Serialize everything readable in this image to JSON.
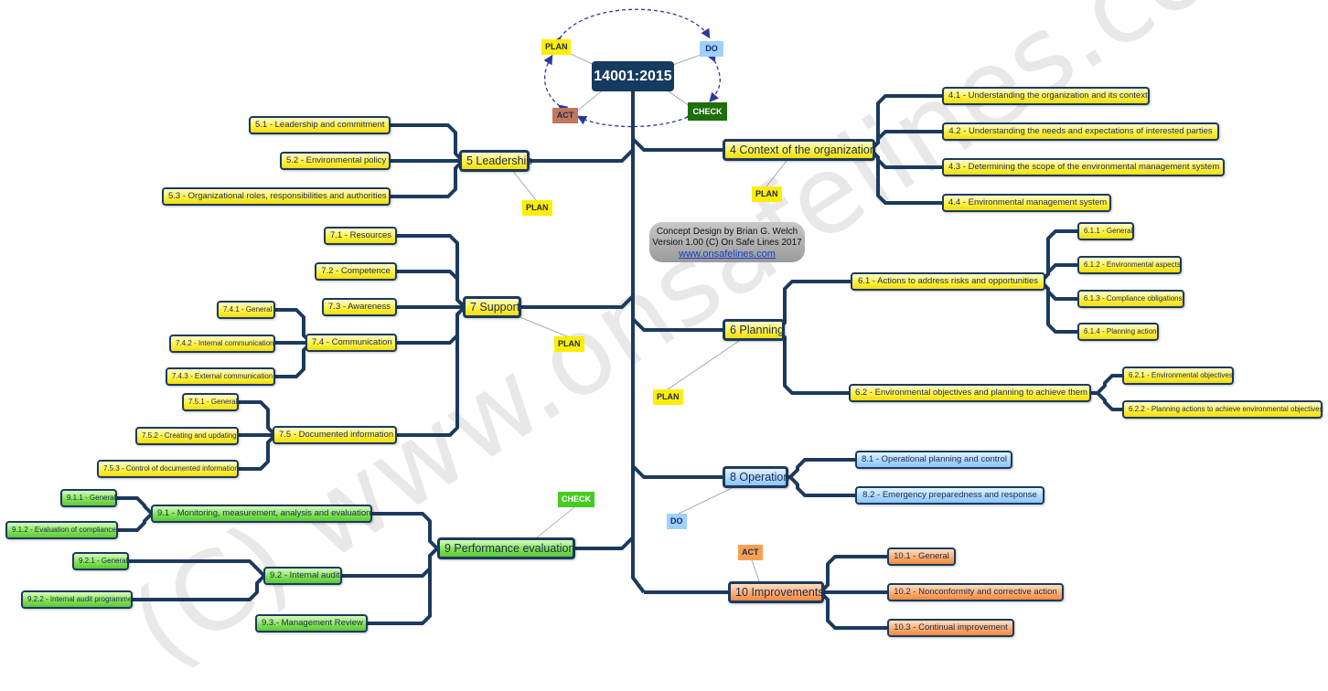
{
  "root": "14001:2015",
  "cycle": {
    "plan": "PLAN",
    "do": "DO",
    "check": "CHECK",
    "act": "ACT",
    "colors": {
      "plan": "#ffee00",
      "do": "#9fd0ff",
      "check": "#1e6e0e",
      "act": "#c0785a"
    }
  },
  "credit": {
    "line1": "Concept Design by Brian G. Welch",
    "line2": "Version 1.00 (C) On Safe Lines 2017",
    "link": "www.onsafelines.com"
  },
  "watermark": "(C) www.onsafelines.com",
  "tags": {
    "t5": "PLAN",
    "t4": "PLAN",
    "t7": "PLAN",
    "t6": "PLAN",
    "t9": "CHECK",
    "t8": "DO",
    "t10": "ACT"
  },
  "nodes": {
    "n4": "4 Context of the organization",
    "n4_1": "4.1 - Understanding the organization and its context",
    "n4_2": "4.2 - Understanding the needs and expectations of interested parties",
    "n4_3": "4.3 - Determining the scope of the environmental management system",
    "n4_4": "4.4 - Environmental management system",
    "n5": "5 Leadership",
    "n5_1": "5.1 - Leadership and commitment",
    "n5_2": "5.2 - Environmental policy",
    "n5_3": "5.3 - Organizational roles, responsibilities and authorities",
    "n6": "6 Planning",
    "n6_1": "6.1 - Actions to address risks and opportunities",
    "n6_1_1": "6.1.1 - General",
    "n6_1_2": "6.1.2 - Environmental aspects",
    "n6_1_3": "6.1.3 - Compliance obligations",
    "n6_1_4": "6.1.4 - Planning action",
    "n6_2": "6.2 - Environmental objectives and planning to achieve them",
    "n6_2_1": "6.2.1 - Environmental objectives",
    "n6_2_2": "6.2.2 - Planning actions to achieve environmental objectives",
    "n7": "7 Support",
    "n7_1": "7.1 - Resources",
    "n7_2": "7.2 - Competence",
    "n7_3": "7.3 - Awareness",
    "n7_4": "7.4 - Communication",
    "n7_4_1": "7.4.1 - General",
    "n7_4_2": "7.4.2 - Internal communication",
    "n7_4_3": "7.4.3 - External communication",
    "n7_5": "7.5 - Documented information",
    "n7_5_1": "7.5.1 - General",
    "n7_5_2": "7.5.2 - Creating and updating",
    "n7_5_3": "7.5.3 - Control of documented information",
    "n8": "8 Operation",
    "n8_1": "8.1 - Operational planning and control",
    "n8_2": "8.2 - Emergency preparedness and response",
    "n9": "9 Performance evaluation",
    "n9_1": "9.1 - Monitoring, measurement, analysis and evaluation",
    "n9_1_1": "9.1.1 - General",
    "n9_1_2": "9.1.2 - Evaluation of compliance",
    "n9_2": "9.2 - Internal audit",
    "n9_2_1": "9.2.1 - General",
    "n9_2_2": "9.2.2 - Internal audit programme",
    "n9_3": "9.3.- Management Review",
    "n10": "10 Improvements",
    "n10_1": "10.1 - General",
    "n10_2": "10.2 - Nonconformity and corrective action",
    "n10_3": "10.3 - Continual improvement"
  }
}
